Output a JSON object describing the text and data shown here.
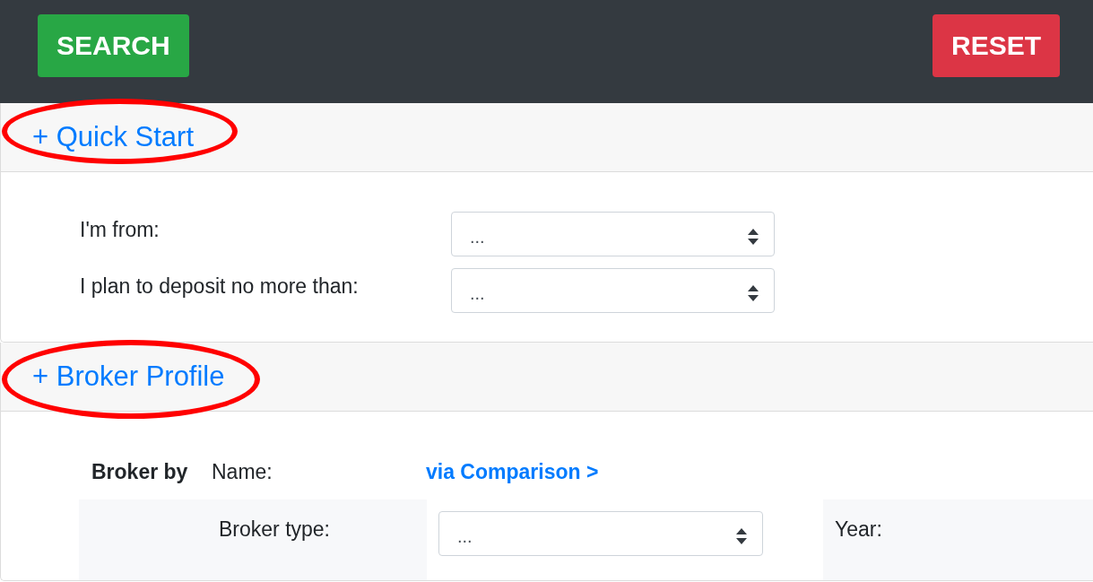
{
  "toolbar": {
    "buttons": [
      {
        "label": "SEARCH",
        "kind": "primary"
      },
      {
        "label": "RESET",
        "kind": "danger"
      }
    ]
  },
  "sections": [
    {
      "title": "+ Quick Start",
      "highlighted": true,
      "kind": "form",
      "fields": [
        {
          "label": "I'm from:",
          "value": "..."
        },
        {
          "label": "I plan to deposit no more than:",
          "value": "..."
        }
      ]
    },
    {
      "title": "+ Broker Profile",
      "highlighted": true,
      "kind": "profile",
      "group_label": "Broker by",
      "name_label": "Name:",
      "name_link": "via Comparison >",
      "type_label": "Broker type:",
      "type_value": "...",
      "year_label": "Year:"
    }
  ]
}
